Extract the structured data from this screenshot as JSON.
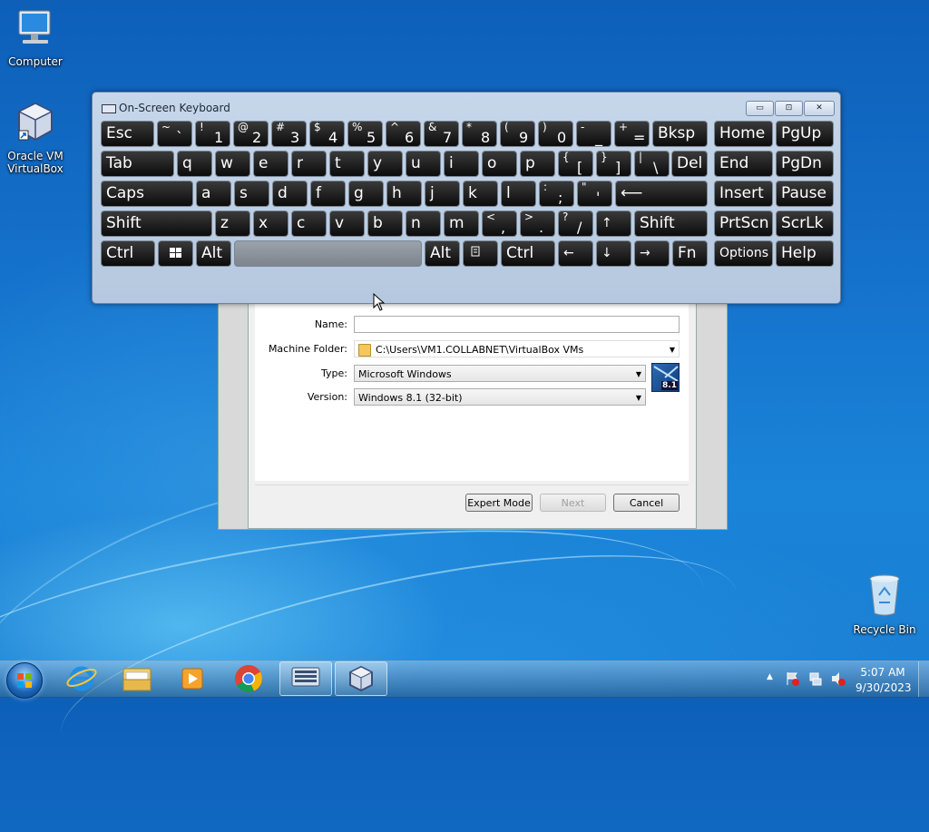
{
  "desktop": {
    "icons": [
      {
        "label": "Computer",
        "icon": "computer-icon"
      },
      {
        "label": "Oracle VM VirtualBox",
        "icon": "virtualbox-icon"
      },
      {
        "label": "Recycle Bin",
        "icon": "recycle-bin-icon"
      }
    ]
  },
  "osk": {
    "title": "On-Screen Keyboard",
    "controls": {
      "minimize": "▭",
      "maximize": "⊡",
      "close": "✕"
    },
    "keys": {
      "esc": "Esc",
      "bksp": "Bksp",
      "home": "Home",
      "pgup": "PgUp",
      "tab": "Tab",
      "del": "Del",
      "end": "End",
      "pgdn": "PgDn",
      "caps": "Caps",
      "insert": "Insert",
      "pause": "Pause",
      "shift": "Shift",
      "prtscn": "PrtScn",
      "scrlk": "ScrLk",
      "ctrl": "Ctrl",
      "alt": "Alt",
      "fn": "Fn",
      "options": "Options",
      "help": "Help",
      "row1": [
        [
          "~",
          "`"
        ],
        [
          "!",
          "1"
        ],
        [
          "@",
          "2"
        ],
        [
          "#",
          "3"
        ],
        [
          "$",
          "4"
        ],
        [
          "%",
          "5"
        ],
        [
          "^",
          "6"
        ],
        [
          "&",
          "7"
        ],
        [
          "*",
          "8"
        ],
        [
          "(",
          "9"
        ],
        [
          ")",
          "0"
        ],
        [
          "-",
          "_"
        ],
        [
          "+",
          "="
        ]
      ],
      "row2": [
        "q",
        "w",
        "e",
        "r",
        "t",
        "y",
        "u",
        "i",
        "o",
        "p"
      ],
      "row2_sym": [
        [
          "{",
          "["
        ],
        [
          "}",
          "]"
        ],
        [
          "|",
          "\\"
        ]
      ],
      "row3": [
        "a",
        "s",
        "d",
        "f",
        "g",
        "h",
        "j",
        "k",
        "l"
      ],
      "row3_sym": [
        [
          ":",
          ";"
        ],
        [
          "\"",
          "'"
        ]
      ],
      "row4": [
        "z",
        "x",
        "c",
        "v",
        "b",
        "n",
        "m"
      ],
      "row4_sym": [
        [
          "<",
          ","
        ],
        [
          ">",
          "."
        ],
        [
          "?",
          "/"
        ]
      ],
      "arrows": {
        "up": "↑",
        "down": "↓",
        "left": "←",
        "right": "→"
      },
      "enter": "⟵"
    }
  },
  "vbox": {
    "name_label": "Name:",
    "name_value": "",
    "folder_label": "Machine Folder:",
    "folder_value": "C:\\Users\\VM1.COLLABNET\\VirtualBox VMs",
    "type_label": "Type:",
    "type_value": "Microsoft Windows",
    "version_label": "Version:",
    "version_value": "Windows 8.1 (32-bit)",
    "os_badge": "8.1",
    "buttons": {
      "expert": "Expert Mode",
      "next": "Next",
      "cancel": "Cancel"
    }
  },
  "taskbar": {
    "apps": [
      "internet-explorer-icon",
      "file-explorer-icon",
      "media-player-icon",
      "chrome-icon",
      "on-screen-keyboard-icon",
      "virtualbox-icon"
    ],
    "time": "5:07 AM",
    "date": "9/30/2023",
    "tray_arrow": "▲"
  }
}
